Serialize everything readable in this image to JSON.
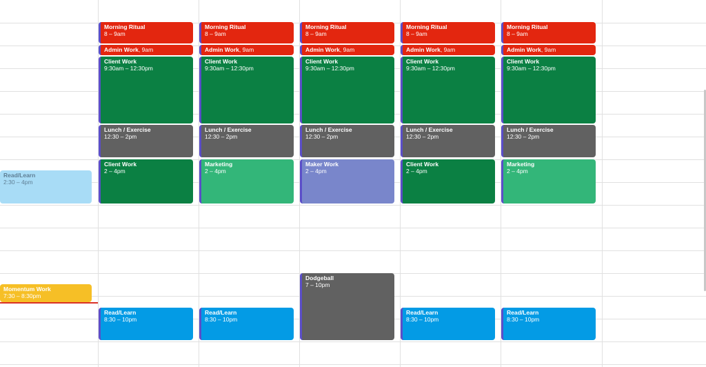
{
  "colors": {
    "tomato": "#f4511e",
    "red": "#e3260f",
    "basil": "#0b8043",
    "graphite": "#616161",
    "sage": "#33b679",
    "lavender": "#7986cb",
    "peacock": "#039be5",
    "banana": "#f6bf26",
    "light_blue": "#a8dcf6",
    "now_indicator": "#d93025"
  },
  "events": [
    {
      "title": "Read/Learn",
      "time": "2:30 – 4pm",
      "color": "light_blue"
    },
    {
      "title": "Momentum Work",
      "time": "7:30 – 8:30pm",
      "color": "banana"
    },
    {
      "title": "Morning Ritual",
      "time": "8 – 9am",
      "color": "red"
    },
    {
      "title": "Admin Work",
      "time": "9am",
      "color": "red"
    },
    {
      "title": "Client Work",
      "time": "9:30am – 12:30pm",
      "color": "basil"
    },
    {
      "title": "Lunch / Exercise",
      "time": "12:30 – 2pm",
      "color": "graphite"
    },
    {
      "title": "Client Work",
      "time": "2 – 4pm",
      "color": "basil"
    },
    {
      "title": "Read/Learn",
      "time": "8:30 – 10pm",
      "color": "peacock"
    },
    {
      "title": "Morning Ritual",
      "time": "8 – 9am",
      "color": "red"
    },
    {
      "title": "Admin Work",
      "time": "9am",
      "color": "red"
    },
    {
      "title": "Client Work",
      "time": "9:30am – 12:30pm",
      "color": "basil"
    },
    {
      "title": "Lunch / Exercise",
      "time": "12:30 – 2pm",
      "color": "graphite"
    },
    {
      "title": "Marketing",
      "time": "2 – 4pm",
      "color": "sage"
    },
    {
      "title": "Read/Learn",
      "time": "8:30 – 10pm",
      "color": "peacock"
    },
    {
      "title": "Morning Ritual",
      "time": "8 – 9am",
      "color": "red"
    },
    {
      "title": "Admin Work",
      "time": "9am",
      "color": "red"
    },
    {
      "title": "Client Work",
      "time": "9:30am – 12:30pm",
      "color": "basil"
    },
    {
      "title": "Lunch / Exercise",
      "time": "12:30 – 2pm",
      "color": "graphite"
    },
    {
      "title": "Maker Work",
      "time": "2 – 4pm",
      "color": "lavender"
    },
    {
      "title": "Dodgeball",
      "time": "7 – 10pm",
      "color": "graphite"
    },
    {
      "title": "Morning Ritual",
      "time": "8 – 9am",
      "color": "red"
    },
    {
      "title": "Admin Work",
      "time": "9am",
      "color": "red"
    },
    {
      "title": "Client Work",
      "time": "9:30am – 12:30pm",
      "color": "basil"
    },
    {
      "title": "Lunch / Exercise",
      "time": "12:30 – 2pm",
      "color": "graphite"
    },
    {
      "title": "Client Work",
      "time": "2 – 4pm",
      "color": "basil"
    },
    {
      "title": "Read/Learn",
      "time": "8:30 – 10pm",
      "color": "peacock"
    },
    {
      "title": "Morning Ritual",
      "time": "8 – 9am",
      "color": "red"
    },
    {
      "title": "Admin Work",
      "time": "9am",
      "color": "red"
    },
    {
      "title": "Client Work",
      "time": "9:30am – 12:30pm",
      "color": "basil"
    },
    {
      "title": "Lunch / Exercise",
      "time": "12:30 – 2pm",
      "color": "graphite"
    },
    {
      "title": "Marketing",
      "time": "2 – 4pm",
      "color": "sage"
    },
    {
      "title": "Read/Learn",
      "time": "8:30 – 10pm",
      "color": "peacock"
    }
  ]
}
